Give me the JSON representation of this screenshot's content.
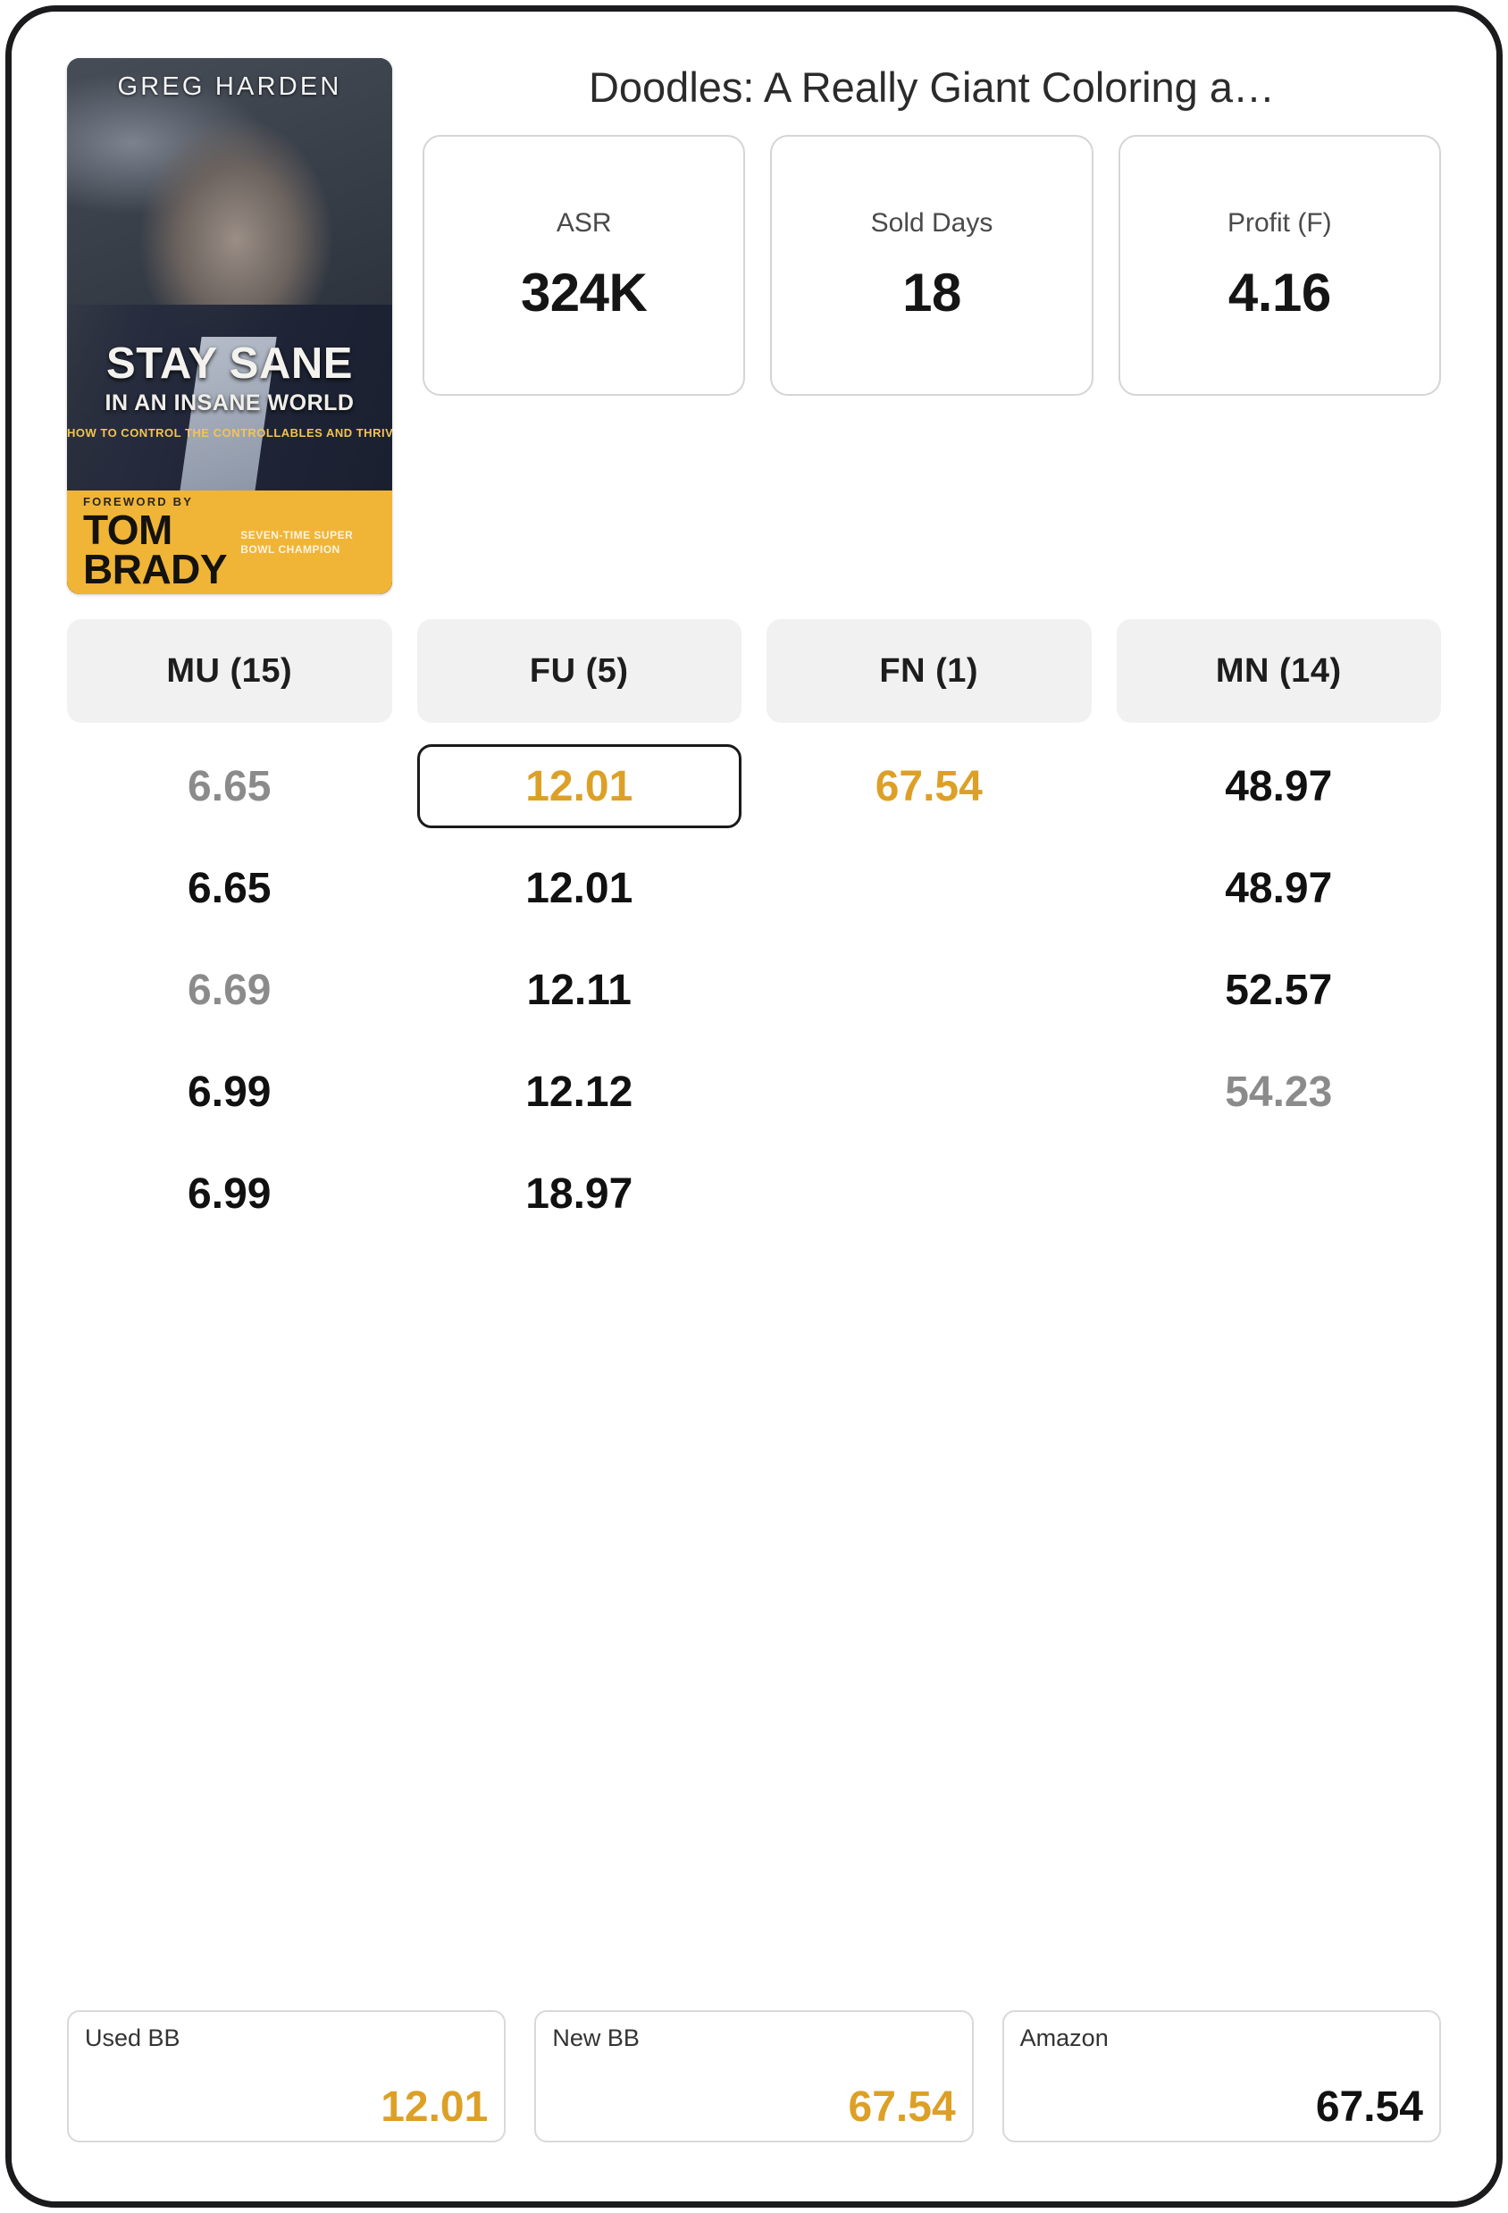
{
  "header": {
    "book_title": "Doodles: A Really Giant Coloring a…",
    "cover": {
      "author": "GREG HARDEN",
      "title_line1": "STAY SANE",
      "title_line2": "IN AN INSANE WORLD",
      "tagline": "HOW TO CONTROL THE CONTROLLABLES AND THRIVE",
      "foreword_label": "FOREWORD BY",
      "foreword_name": "TOM BRADY",
      "foreword_credit": "SEVEN-TIME SUPER BOWL CHAMPION"
    }
  },
  "metrics": [
    {
      "label": "ASR",
      "value": "324K"
    },
    {
      "label": "Sold Days",
      "value": "18"
    },
    {
      "label": "Profit (F)",
      "value": "4.16"
    }
  ],
  "tabs": [
    {
      "label": "MU  (15)",
      "code": "MU",
      "count": 15
    },
    {
      "label": "FU  (5)",
      "code": "FU",
      "count": 5
    },
    {
      "label": "FN  (1)",
      "code": "FN",
      "count": 1
    },
    {
      "label": "MN  (14)",
      "code": "MN",
      "count": 14
    }
  ],
  "table": {
    "columns": [
      "MU",
      "FU",
      "FN",
      "MN"
    ],
    "rows": [
      [
        {
          "value": "6.65",
          "style": "gray",
          "selected": false
        },
        {
          "value": "12.01",
          "style": "gold",
          "selected": true
        },
        {
          "value": "67.54",
          "style": "gold",
          "selected": false
        },
        {
          "value": "48.97",
          "style": "black",
          "selected": false
        }
      ],
      [
        {
          "value": "6.65",
          "style": "black",
          "selected": false
        },
        {
          "value": "12.01",
          "style": "black",
          "selected": false
        },
        {
          "value": "",
          "style": "black",
          "selected": false
        },
        {
          "value": "48.97",
          "style": "black",
          "selected": false
        }
      ],
      [
        {
          "value": "6.69",
          "style": "gray",
          "selected": false
        },
        {
          "value": "12.11",
          "style": "black",
          "selected": false
        },
        {
          "value": "",
          "style": "black",
          "selected": false
        },
        {
          "value": "52.57",
          "style": "black",
          "selected": false
        }
      ],
      [
        {
          "value": "6.99",
          "style": "black",
          "selected": false
        },
        {
          "value": "12.12",
          "style": "black",
          "selected": false
        },
        {
          "value": "",
          "style": "black",
          "selected": false
        },
        {
          "value": "54.23",
          "style": "gray",
          "selected": false
        }
      ],
      [
        {
          "value": "6.99",
          "style": "black",
          "selected": false
        },
        {
          "value": "18.97",
          "style": "black",
          "selected": false
        },
        {
          "value": "",
          "style": "black",
          "selected": false
        },
        {
          "value": "",
          "style": "black",
          "selected": false
        }
      ]
    ]
  },
  "bottom_cards": [
    {
      "label": "Used BB",
      "value": "12.01",
      "style": "gold"
    },
    {
      "label": "New BB",
      "value": "67.54",
      "style": "gold"
    },
    {
      "label": "Amazon",
      "value": "67.54",
      "style": "black"
    }
  ],
  "colors": {
    "accent_gold": "#dda027",
    "text_primary": "#111111",
    "text_muted": "#8b8b8b",
    "tab_background": "#f1f1f1",
    "card_border": "#d5d5d5",
    "cover_band": "#f0b537"
  }
}
